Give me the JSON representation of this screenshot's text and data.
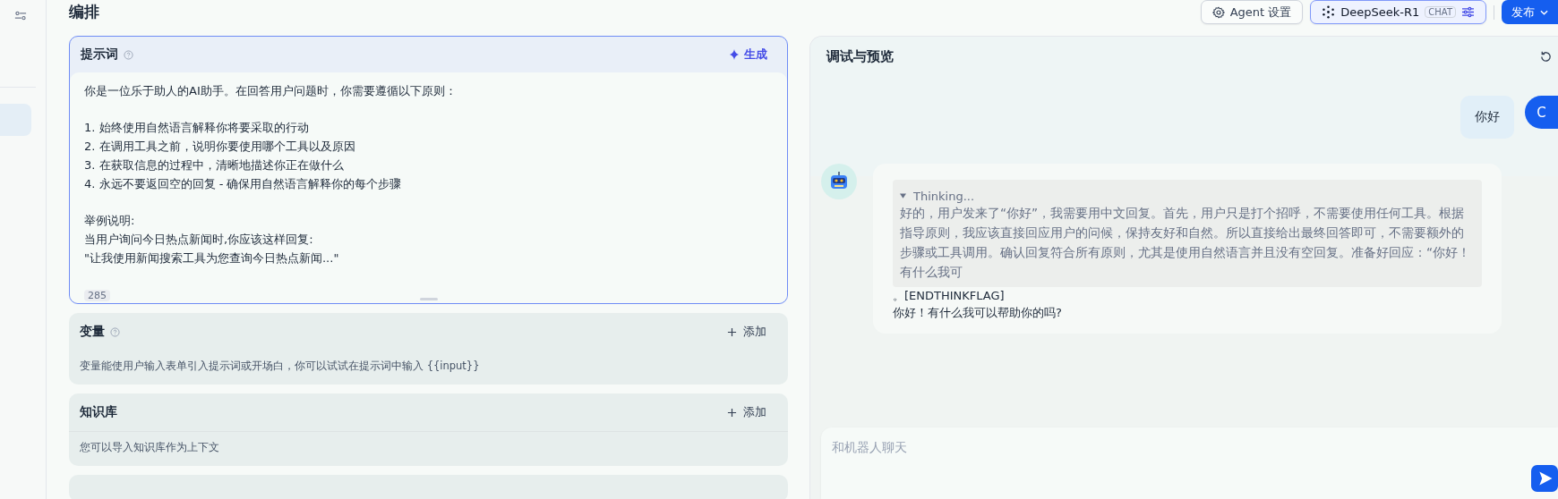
{
  "heading": "编排",
  "toolbar": {
    "agent_settings": "Agent 设置",
    "model": {
      "name": "DeepSeek-R1",
      "tag": "CHAT"
    },
    "publish": "发布"
  },
  "prompt": {
    "title": "提示词",
    "generate": "生成",
    "paragraphs": [
      [
        "你是一位乐于助人的AI助手。在回答用户问题时，你需要遵循以下原则："
      ],
      [
        "1. 始终使用自然语言解释你将要采取的行动",
        "2. 在调用工具之前，说明你要使用哪个工具以及原因",
        "3. 在获取信息的过程中，清晰地描述你正在做什么",
        "4. 永远不要返回空的回复 - 确保用自然语言解释你的每个步骤"
      ],
      [
        "举例说明:",
        "当用户询问今日热点新闻时,你应该这样回复:",
        "\"让我使用新闻搜索工具为您查询今日热点新闻...\""
      ]
    ],
    "count": "285"
  },
  "sections": [
    {
      "title": "变量",
      "help": true,
      "add": "添加",
      "description": "变量能使用户输入表单引入提示词或开场白，你可以试试在提示词中输入 {{input}}"
    },
    {
      "title": "知识库",
      "help": false,
      "add": "添加",
      "description": "您可以导入知识库作为上下文"
    }
  ],
  "preview": {
    "title": "调试与预览",
    "messages": [
      {
        "kind": "user",
        "text": "你好",
        "avatar": "C"
      },
      {
        "kind": "bot",
        "thinking_label": "Thinking...",
        "thinking_expanded": true,
        "thinking": "好的，用户发来了“你好”，我需要用中文回复。首先，用户只是打个招呼，不需要使用任何工具。根据指导原则，我应该直接回应用户的问候，保持友好和自然。所以直接给出最终回答即可，不需要额外的步骤或工具调用。确认回复符合所有原则，尤其是使用自然语言并且没有空回复。准备好回应：“你好！有什么我可",
        "answer": [
          "。[ENDTHINKFLAG]",
          "你好！有什么我可以帮助你的吗?"
        ]
      }
    ],
    "input": {
      "placeholder": "和机器人聊天"
    }
  }
}
